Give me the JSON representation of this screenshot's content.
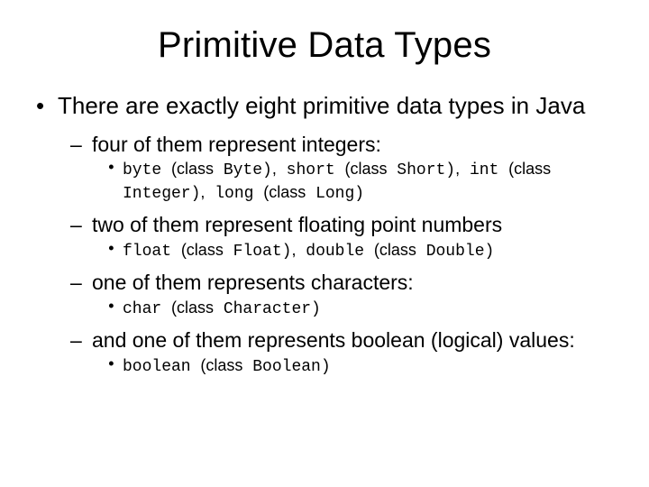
{
  "title": "Primitive Data Types",
  "l1": "There are exactly eight primitive data types in Java",
  "sections": [
    {
      "heading": "four of them represent integers:",
      "code_html": "byte <r>(class</r> Byte)<r>,</r> short <r>(class</r> Short)<r>,</r> int <r>(class</r> Integer)<r>,</r> long <r>(class</r> Long)"
    },
    {
      "heading": "two of them represent floating point numbers",
      "code_html": "float <r>(class</r> Float)<r>,</r> double <r>(class</r> Double)"
    },
    {
      "heading": "one of them represents characters:",
      "code_html": "char <r>(class</r> Character)"
    },
    {
      "heading": "and one of them represents boolean (logical) values:",
      "code_html": "boolean <r>(class</r> Boolean)"
    }
  ]
}
